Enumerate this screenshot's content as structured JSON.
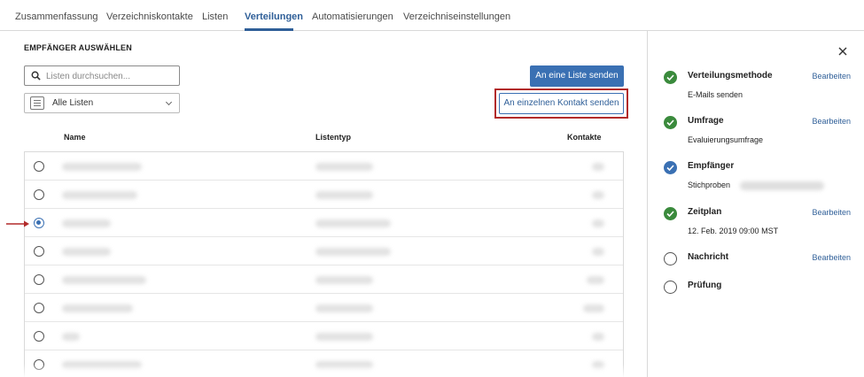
{
  "tabs": [
    {
      "label": "Zusammenfassung",
      "active": false
    },
    {
      "label": "Verzeichniskontakte",
      "active": false
    },
    {
      "label": "Listen",
      "active": false
    },
    {
      "label": "Verteilungen",
      "active": true
    },
    {
      "label": "Automatisierungen",
      "active": false
    },
    {
      "label": "Verzeichniseinstellungen",
      "active": false
    }
  ],
  "recipients": {
    "section_title": "EMPFÄNGER AUSWÄHLEN",
    "search_placeholder": "Listen durchsuchen...",
    "filter_value": "Alle Listen",
    "send_list_button": "An eine Liste senden",
    "send_contact_button": "An einzelnen Kontakt senden",
    "columns": {
      "name": "Name",
      "type": "Listentyp",
      "contacts": "Kontakte"
    },
    "rows": [
      {
        "selected": false
      },
      {
        "selected": false
      },
      {
        "selected": true
      },
      {
        "selected": false
      },
      {
        "selected": false
      },
      {
        "selected": false
      },
      {
        "selected": false
      },
      {
        "selected": false
      }
    ]
  },
  "steps": [
    {
      "title": "Verteilungsmethode",
      "subtitle": "E-Mails senden",
      "status": "done",
      "edit": "Bearbeiten"
    },
    {
      "title": "Umfrage",
      "subtitle": "Evaluierungsumfrage",
      "status": "done",
      "edit": "Bearbeiten"
    },
    {
      "title": "Empfänger",
      "subtitle": "Stichproben",
      "status": "current",
      "edit": ""
    },
    {
      "title": "Zeitplan",
      "subtitle": "12. Feb. 2019 09:00 MST",
      "status": "done",
      "edit": "Bearbeiten"
    },
    {
      "title": "Nachricht",
      "subtitle": "",
      "status": "todo",
      "edit": "Bearbeiten"
    },
    {
      "title": "Prüfung",
      "subtitle": "",
      "status": "todo",
      "edit": ""
    }
  ],
  "colors": {
    "accent": "#3a70b3",
    "success": "#3a8a3c",
    "highlight": "#b22a2a"
  }
}
